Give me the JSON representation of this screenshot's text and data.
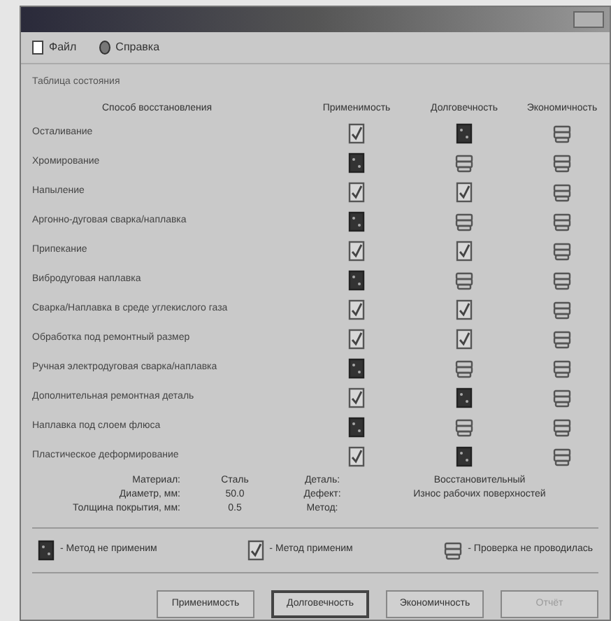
{
  "menu": [
    {
      "label": "Файл",
      "kind": "file"
    },
    {
      "label": "Справка",
      "kind": "help"
    }
  ],
  "section_title": "Таблица состояния",
  "columns": [
    "Способ восстановления",
    "Применимость",
    "Долговечность",
    "Экономичность"
  ],
  "rows": [
    {
      "method": "Осталивание",
      "cells": [
        {
          "kind": "applicable"
        },
        {
          "kind": "inapplicable"
        },
        {
          "kind": "unchecked"
        }
      ]
    },
    {
      "method": "Хромирование",
      "cells": [
        {
          "kind": "inapplicable"
        },
        {
          "kind": "unchecked"
        },
        {
          "kind": "unchecked"
        }
      ]
    },
    {
      "method": "Напыление",
      "cells": [
        {
          "kind": "applicable"
        },
        {
          "kind": "applicable"
        },
        {
          "kind": "unchecked"
        }
      ]
    },
    {
      "method": "Аргонно-дуговая сварка/наплавка",
      "cells": [
        {
          "kind": "inapplicable"
        },
        {
          "kind": "unchecked"
        },
        {
          "kind": "unchecked"
        }
      ]
    },
    {
      "method": "Припекание",
      "cells": [
        {
          "kind": "applicable"
        },
        {
          "kind": "applicable"
        },
        {
          "kind": "unchecked"
        }
      ]
    },
    {
      "method": "Вибродуговая наплавка",
      "cells": [
        {
          "kind": "inapplicable"
        },
        {
          "kind": "unchecked"
        },
        {
          "kind": "unchecked"
        }
      ]
    },
    {
      "method": "Сварка/Наплавка в среде углекислого газа",
      "cells": [
        {
          "kind": "applicable"
        },
        {
          "kind": "applicable"
        },
        {
          "kind": "unchecked"
        }
      ]
    },
    {
      "method": "Обработка под ремонтный размер",
      "cells": [
        {
          "kind": "applicable"
        },
        {
          "kind": "applicable"
        },
        {
          "kind": "unchecked"
        }
      ]
    },
    {
      "method": "Ручная электродуговая сварка/наплавка",
      "cells": [
        {
          "kind": "inapplicable"
        },
        {
          "kind": "unchecked"
        },
        {
          "kind": "unchecked"
        }
      ]
    },
    {
      "method": "Дополнительная ремонтная деталь",
      "cells": [
        {
          "kind": "applicable"
        },
        {
          "kind": "inapplicable"
        },
        {
          "kind": "unchecked"
        }
      ]
    },
    {
      "method": "Наплавка под слоем флюса",
      "cells": [
        {
          "kind": "inapplicable"
        },
        {
          "kind": "unchecked"
        },
        {
          "kind": "unchecked"
        }
      ]
    },
    {
      "method": "Пластическое деформирование",
      "cells": [
        {
          "kind": "applicable"
        },
        {
          "kind": "inapplicable"
        },
        {
          "kind": "unchecked"
        }
      ]
    }
  ],
  "info": [
    {
      "label": "Материал:",
      "value": "Сталь",
      "label2": "Деталь:",
      "value2": "Восстановительный"
    },
    {
      "label": "Диаметр, мм:",
      "value": "50.0",
      "label2": "Дефект:",
      "value2": "Износ рабочих поверхностей"
    },
    {
      "label": "Толщина покрытия, мм:",
      "value": "0.5",
      "label2": "Метод:"
    }
  ],
  "legend": [
    {
      "kind": "inapplicable",
      "text": "- Метод не применим"
    },
    {
      "kind": "applicable",
      "text": "- Метод применим"
    },
    {
      "kind": "unchecked",
      "text": "- Проверка не проводилась"
    }
  ],
  "buttons": [
    {
      "label": "Применимость",
      "focused": false,
      "disabled": false
    },
    {
      "label": "Долговечность",
      "focused": true,
      "disabled": false
    },
    {
      "label": "Экономичность",
      "focused": false,
      "disabled": false
    },
    {
      "label": "Отчёт",
      "focused": false,
      "disabled": true
    }
  ]
}
